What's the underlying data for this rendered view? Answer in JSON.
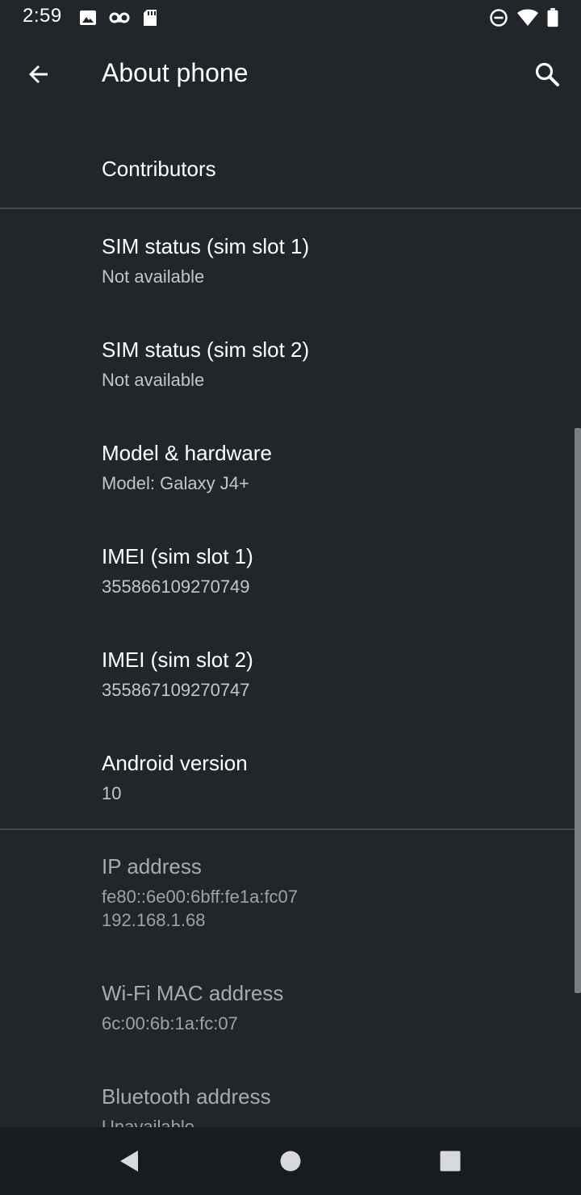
{
  "status_bar": {
    "time": "2:59",
    "left_icons": [
      "image-icon",
      "voicemail-icon",
      "sd-card-icon"
    ],
    "right_icons": [
      "do-not-disturb-icon",
      "wifi-icon",
      "battery-icon"
    ]
  },
  "app_bar": {
    "title": "About phone",
    "back_icon": "arrow-back-icon",
    "search_icon": "search-icon"
  },
  "list": {
    "contributors": {
      "title": "Contributors"
    },
    "sim_status_1": {
      "title": "SIM status (sim slot 1)",
      "summary": "Not available"
    },
    "sim_status_2": {
      "title": "SIM status (sim slot 2)",
      "summary": "Not available"
    },
    "model_hardware": {
      "title": "Model & hardware",
      "summary": "Model: Galaxy J4+"
    },
    "imei_1": {
      "title": "IMEI (sim slot 1)",
      "summary": "355866109270749"
    },
    "imei_2": {
      "title": "IMEI (sim slot 2)",
      "summary": "355867109270747"
    },
    "android_version": {
      "title": "Android version",
      "summary": "10"
    },
    "ip_address": {
      "title": "IP address",
      "summary": "fe80::6e00:6bff:fe1a:fc07\n192.168.1.68"
    },
    "wifi_mac": {
      "title": "Wi-Fi MAC address",
      "summary": "6c:00:6b:1a:fc:07"
    },
    "bluetooth_address": {
      "title": "Bluetooth address",
      "summary": "Unavailable"
    }
  },
  "nav_bar": {
    "icons": [
      "back-triangle-icon",
      "home-circle-icon",
      "recents-square-icon"
    ]
  },
  "colors": {
    "background": "#21262b",
    "nav_background": "#191c1f",
    "divider": "#454a4f",
    "text_primary": "#ffffff",
    "text_secondary": "#c2c6ca"
  }
}
